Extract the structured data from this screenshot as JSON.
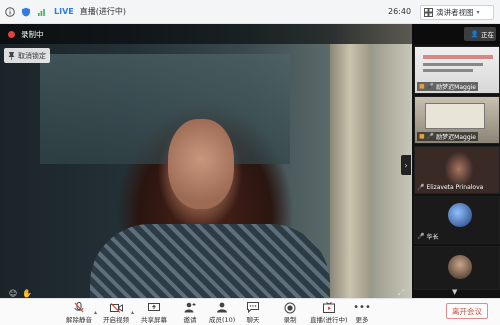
{
  "topbar": {
    "live_label": "LIVE",
    "title": "直播(进行中)",
    "timer": "26:40",
    "view_button": "演讲者视图"
  },
  "stage": {
    "recording_label": "录制中",
    "unpin_label": "取消锁定"
  },
  "panel": {
    "presenter_label": "正在",
    "participants": [
      {
        "name": "励梦迟Maggie"
      },
      {
        "name": "励梦迟Maggie"
      },
      {
        "name": "Elizaveta Prinalova"
      },
      {
        "name": "华长"
      },
      {
        "name": ""
      }
    ]
  },
  "toolbar": {
    "mute_label": "解除静音",
    "video_label": "开启视频",
    "share_label": "共享屏幕",
    "invite_label": "邀请",
    "members_label": "成员(10)",
    "chat_label": "聊天",
    "record_label": "录制",
    "live_label": "直播(进行中)",
    "more_label": "更多",
    "leave_label": "离开会议"
  },
  "colors": {
    "accent": "#2f7de1",
    "recording": "#e3433b",
    "leave": "#d04a44"
  }
}
